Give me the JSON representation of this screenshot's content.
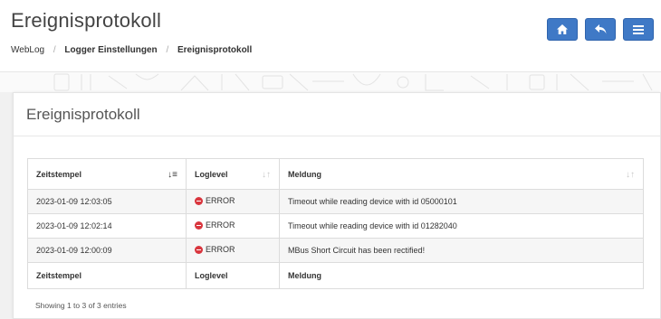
{
  "header": {
    "title": "Ereignisprotokoll",
    "breadcrumb": [
      "WebLog",
      "Logger Einstellungen",
      "Ereignisprotokoll"
    ]
  },
  "toolbar": {
    "buttons": [
      {
        "name": "home",
        "icon": "home-icon"
      },
      {
        "name": "back",
        "icon": "reply-icon"
      },
      {
        "name": "menu",
        "icon": "hamburger-menu-icon"
      }
    ],
    "accent_color": "#3f79c6"
  },
  "panel": {
    "title": "Ereignisprotokoll"
  },
  "table": {
    "columns": [
      "Zeitstempel",
      "Loglevel",
      "Meldung"
    ],
    "sort": {
      "column": "Zeitstempel",
      "direction": "descending"
    },
    "rows": [
      {
        "timestamp": "2023-01-09 12:03:05",
        "level": "ERROR",
        "message": "Timeout while reading device with id 05000101"
      },
      {
        "timestamp": "2023-01-09 12:02:14",
        "level": "ERROR",
        "message": "Timeout while reading device with id 01282040"
      },
      {
        "timestamp": "2023-01-09 12:00:09",
        "level": "ERROR",
        "message": "MBus Short Circuit has been rectified!"
      }
    ],
    "footer": [
      "Zeitstempel",
      "Loglevel",
      "Meldung"
    ],
    "error_color": "#d9363e"
  },
  "info": "Showing 1 to 3 of 3 entries"
}
